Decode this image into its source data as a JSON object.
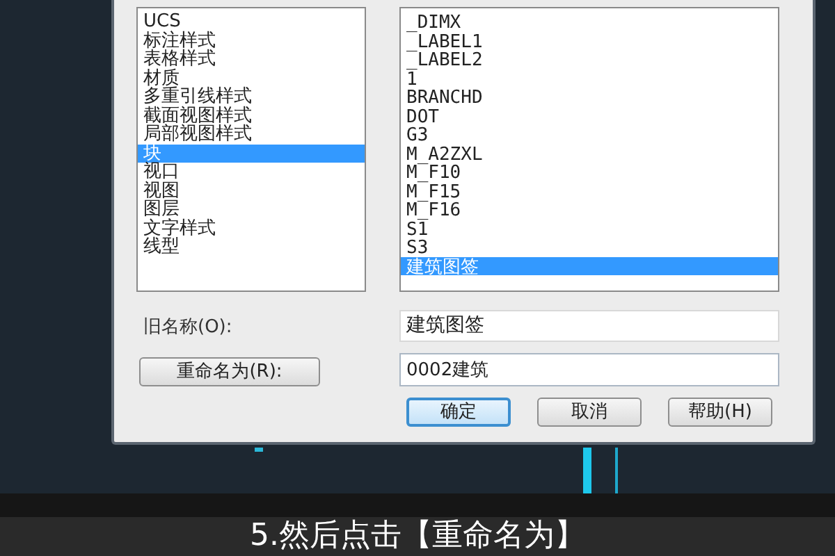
{
  "dialog": {
    "object_list": {
      "items": [
        {
          "label": "UCS",
          "selected": false
        },
        {
          "label": "标注样式",
          "selected": false
        },
        {
          "label": "表格样式",
          "selected": false
        },
        {
          "label": "材质",
          "selected": false
        },
        {
          "label": "多重引线样式",
          "selected": false
        },
        {
          "label": "截面视图样式",
          "selected": false
        },
        {
          "label": "局部视图样式",
          "selected": false
        },
        {
          "label": "块",
          "selected": true
        },
        {
          "label": "视口",
          "selected": false
        },
        {
          "label": "视图",
          "selected": false
        },
        {
          "label": "图层",
          "selected": false
        },
        {
          "label": "文字样式",
          "selected": false
        },
        {
          "label": "线型",
          "selected": false
        }
      ]
    },
    "item_list": {
      "items": [
        {
          "label": "_DIMX",
          "selected": false
        },
        {
          "label": "_LABEL1",
          "selected": false
        },
        {
          "label": "_LABEL2",
          "selected": false
        },
        {
          "label": "1",
          "selected": false
        },
        {
          "label": "BRANCHD",
          "selected": false
        },
        {
          "label": "DOT",
          "selected": false
        },
        {
          "label": "G3",
          "selected": false
        },
        {
          "label": "M_A2ZXL",
          "selected": false
        },
        {
          "label": "M_F10",
          "selected": false
        },
        {
          "label": "M_F15",
          "selected": false
        },
        {
          "label": "M_F16",
          "selected": false
        },
        {
          "label": "S1",
          "selected": false
        },
        {
          "label": "S3",
          "selected": false
        },
        {
          "label": "建筑图签",
          "selected": true
        }
      ]
    },
    "old_name": {
      "label": "旧名称(O):",
      "value": "建筑图签"
    },
    "rename_button": "重命名为(R):",
    "new_name": {
      "value": "0002建筑"
    },
    "buttons": [
      {
        "label": "确定",
        "default": true
      },
      {
        "label": "取消",
        "default": false
      },
      {
        "label": "帮助(H)",
        "default": false
      }
    ]
  },
  "subtitle": "5.然后点击【重命名为】"
}
